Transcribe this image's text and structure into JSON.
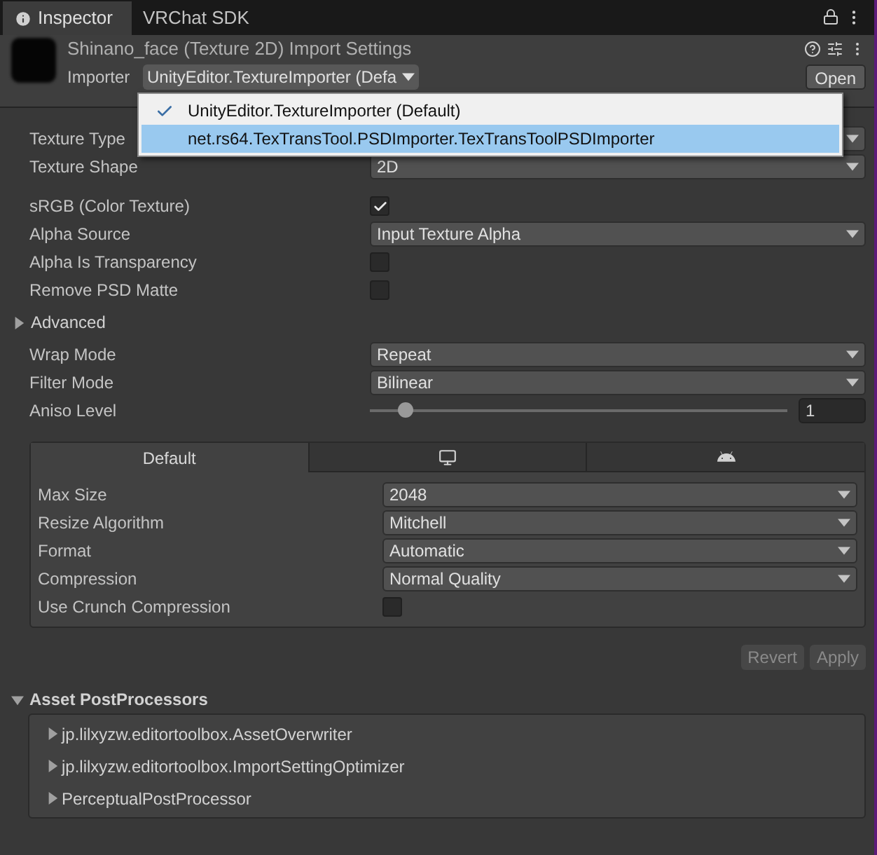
{
  "tabs": [
    {
      "label": "Inspector",
      "selected": true,
      "kind": "info"
    },
    {
      "label": "VRChat SDK",
      "selected": false,
      "kind": "plain"
    }
  ],
  "header": {
    "title": "Shinano_face (Texture 2D) Import Settings",
    "importer_label": "Importer",
    "importer_value": "UnityEditor.TextureImporter (Defa",
    "open_button": "Open"
  },
  "importer_menu": {
    "items": [
      {
        "label": "UnityEditor.TextureImporter (Default)",
        "checked": true,
        "selected": false
      },
      {
        "label": "net.rs64.TexTransTool.PSDImporter.TexTransToolPSDImporter",
        "checked": false,
        "selected": true
      }
    ]
  },
  "settings": [
    {
      "kind": "dropdown",
      "label": "Texture Type"
    },
    {
      "kind": "dropdown",
      "label": "Texture Shape",
      "value": "2D"
    },
    {
      "kind": "gap"
    },
    {
      "kind": "checkbox",
      "label": "sRGB (Color Texture)",
      "checked": true
    },
    {
      "kind": "dropdown",
      "label": "Alpha Source",
      "value": "Input Texture Alpha"
    },
    {
      "kind": "checkbox",
      "label": "Alpha Is Transparency",
      "checked": false
    },
    {
      "kind": "checkbox",
      "label": "Remove PSD Matte",
      "checked": false
    },
    {
      "kind": "foldout",
      "label": "Advanced",
      "expanded": false
    },
    {
      "kind": "dropdown",
      "label": "Wrap Mode",
      "value": "Repeat"
    },
    {
      "kind": "dropdown",
      "label": "Filter Mode",
      "value": "Bilinear"
    },
    {
      "kind": "slider",
      "label": "Aniso Level",
      "level": 0.07,
      "value": "1"
    }
  ],
  "platform_tabs": [
    {
      "kind": "text",
      "label": "Default",
      "selected": true
    },
    {
      "kind": "monitor",
      "selected": false
    },
    {
      "kind": "android",
      "selected": false
    }
  ],
  "platform_settings": [
    {
      "kind": "dropdown",
      "label": "Max Size",
      "value": "2048"
    },
    {
      "kind": "dropdown",
      "label": "Resize Algorithm",
      "value": "Mitchell"
    },
    {
      "kind": "dropdown",
      "label": "Format",
      "value": "Automatic"
    },
    {
      "kind": "dropdown",
      "label": "Compression",
      "value": "Normal Quality"
    },
    {
      "kind": "checkbox",
      "label": "Use Crunch Compression",
      "checked": false
    }
  ],
  "actions": [
    {
      "label": "Revert",
      "disabled": true
    },
    {
      "label": "Apply",
      "disabled": true
    }
  ],
  "postprocessors": {
    "title": "Asset PostProcessors",
    "expanded": true,
    "items": [
      {
        "label": "jp.lilxyzw.editortoolbox.AssetOverwriter",
        "expanded": false
      },
      {
        "label": "jp.lilxyzw.editortoolbox.ImportSettingOptimizer",
        "expanded": false
      },
      {
        "label": "PerceptualPostProcessor",
        "expanded": false
      }
    ]
  }
}
